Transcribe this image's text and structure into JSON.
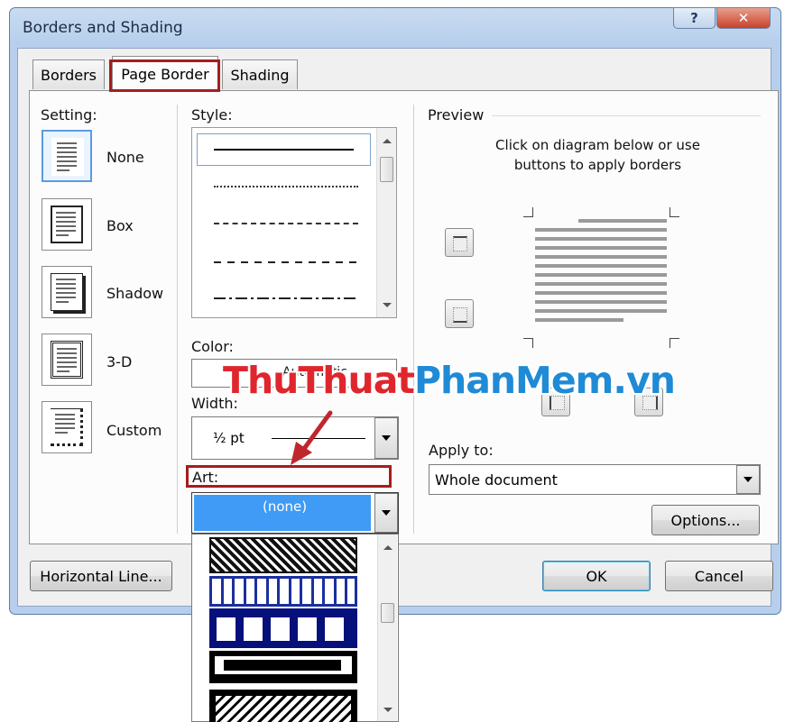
{
  "window": {
    "title": "Borders and Shading",
    "help_glyph": "?",
    "close_glyph": "✕"
  },
  "tabs": [
    {
      "label": "Borders",
      "mnemonic": "B",
      "active": false
    },
    {
      "label": "Page Border",
      "mnemonic": "P",
      "active": true
    },
    {
      "label": "Shading",
      "mnemonic": "S",
      "active": false
    }
  ],
  "setting": {
    "heading": "Setting:",
    "items": [
      {
        "label": "None",
        "mnemonic": "N",
        "selected": true
      },
      {
        "label": "Box",
        "mnemonic": "x"
      },
      {
        "label": "Shadow",
        "mnemonic": "a"
      },
      {
        "label": "3-D",
        "mnemonic": "D"
      },
      {
        "label": "Custom",
        "mnemonic": "u"
      }
    ]
  },
  "style": {
    "label": "Style:",
    "mnemonic": "y",
    "options": [
      "solid",
      "dotted",
      "dashed-small",
      "dashed",
      "dash-dot"
    ]
  },
  "color": {
    "label": "Color:",
    "mnemonic": "C",
    "value": "Automatic"
  },
  "width": {
    "label": "Width:",
    "mnemonic": "W",
    "value": "½ pt"
  },
  "art": {
    "label": "Art:",
    "mnemonic": "r",
    "value": "(none)",
    "list_items": [
      "diamond-pattern-border",
      "blue-key-pattern-border",
      "navy-square-pattern-border",
      "black-frame-pattern-border",
      "black-rope-pattern-border"
    ]
  },
  "preview": {
    "heading": "Preview",
    "instruction": "Click on diagram below or use buttons to apply borders"
  },
  "apply_to": {
    "label": "Apply to:",
    "mnemonic": "l",
    "value": "Whole document"
  },
  "buttons": {
    "options": "Options...",
    "horizontal_line": "Horizontal Line...",
    "ok": "OK",
    "cancel": "Cancel"
  },
  "watermark": {
    "part1": "ThuThuat",
    "part2": "PhanMem",
    "part3": ".vn"
  },
  "colors": {
    "selection": "#3f9bf5",
    "highlight_red": "#a51d1d",
    "watermark_red": "#e0262d",
    "watermark_blue": "#1f8ad6"
  }
}
